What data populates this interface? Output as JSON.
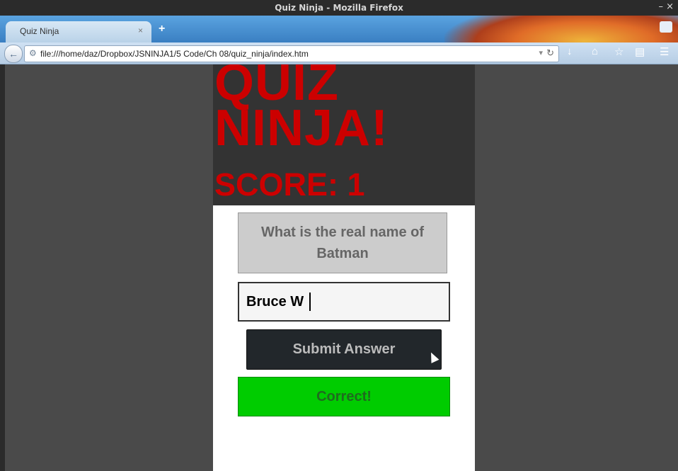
{
  "window": {
    "title": "Quiz Ninja - Mozilla Firefox",
    "controls": "– ×"
  },
  "browser": {
    "tab_label": "Quiz Ninja",
    "tab_close": "×",
    "new_tab": "+",
    "url": "file:///home/daz/Dropbox/JSNINJA1/5 Code/Ch 08/quiz_ninja/index.htm",
    "icons": [
      "back-icon",
      "globe-icon",
      "dropdown-icon",
      "reload-icon",
      "download-icon",
      "home-icon",
      "bookmark-star-icon",
      "reading-list-icon",
      "menu-icon",
      "tab-groups-icon"
    ]
  },
  "page": {
    "title": "QUIZ NINJA!",
    "score": "SCORE: 1",
    "question": "What is the real name of Batman",
    "answer_value": "Bruce W",
    "submit_label": "Submit Answer",
    "feedback": "Correct!",
    "colors": {
      "accent": "#cc0000",
      "header_bg": "#333333",
      "correct": "#00cc00",
      "button_bg": "#22272b"
    }
  }
}
